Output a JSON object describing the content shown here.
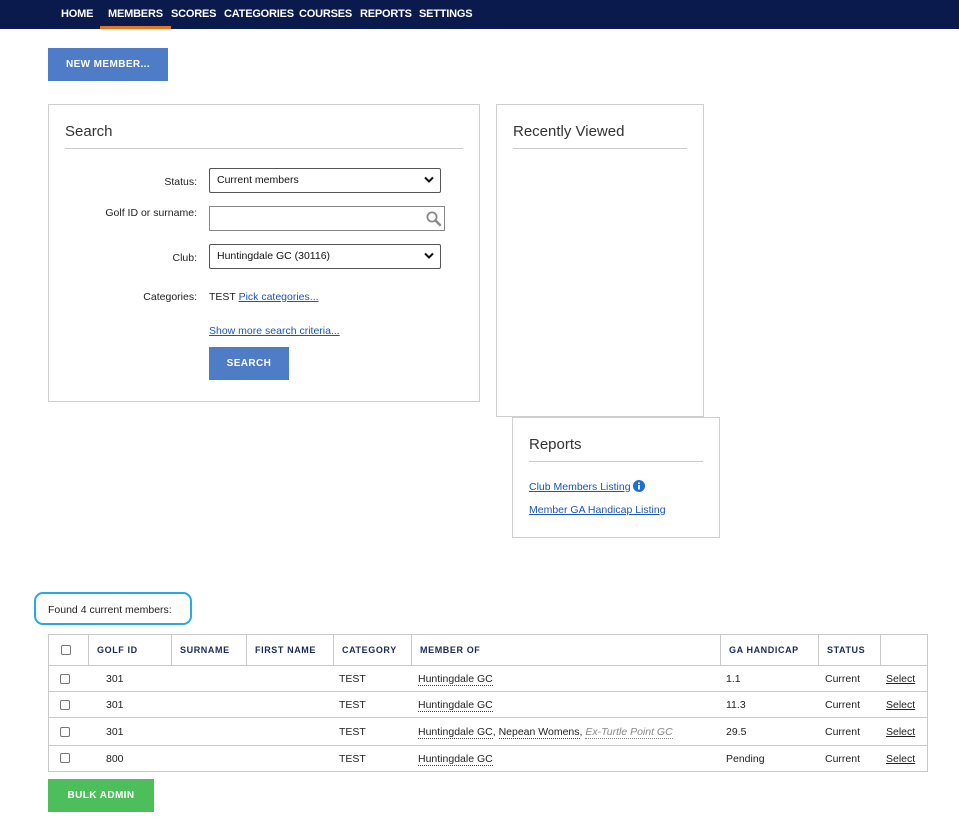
{
  "nav": {
    "items": [
      "HOME",
      "MEMBERS",
      "SCORES",
      "CATEGORIES",
      "COURSES",
      "REPORTS",
      "SETTINGS"
    ],
    "active": "MEMBERS"
  },
  "new_member_label": "NEW MEMBER...",
  "search": {
    "title": "Search",
    "status_label": "Status:",
    "status_value": "Current members",
    "golfid_label": "Golf ID or surname:",
    "golfid_value": "",
    "club_label": "Club:",
    "club_value": "Huntingdale GC (30116)",
    "categories_label": "Categories:",
    "categories_value": "TEST",
    "pick_categories": "Pick categories...",
    "show_more": "Show more search criteria...",
    "search_button": "SEARCH"
  },
  "recently_viewed": {
    "title": "Recently Viewed"
  },
  "reports": {
    "title": "Reports",
    "links": [
      "Club Members Listing",
      "Member GA Handicap Listing"
    ]
  },
  "found_text": "Found 4 current members:",
  "table": {
    "columns": [
      "GOLF ID",
      "SURNAME",
      "FIRST NAME",
      "CATEGORY",
      "MEMBER OF",
      "GA HANDICAP",
      "STATUS"
    ],
    "rows": [
      {
        "golf_id": "301",
        "surname": "",
        "first_name": "",
        "category": "TEST",
        "member_of": [
          "Huntingdale GC"
        ],
        "ex_member_of": "",
        "handicap": "1.1",
        "status": "Current",
        "action": "Select"
      },
      {
        "golf_id": "301",
        "surname": "",
        "first_name": "",
        "category": "TEST",
        "member_of": [
          "Huntingdale GC"
        ],
        "ex_member_of": "",
        "handicap": "11.3",
        "status": "Current",
        "action": "Select"
      },
      {
        "golf_id": "301",
        "surname": "",
        "first_name": "",
        "category": "TEST",
        "member_of": [
          "Huntingdale GC",
          "Nepean Womens"
        ],
        "ex_member_of": "Ex-Turtle Point GC",
        "handicap": "29.5",
        "status": "Current",
        "action": "Select"
      },
      {
        "golf_id": "800",
        "surname": "",
        "first_name": "",
        "category": "TEST",
        "member_of": [
          "Huntingdale GC"
        ],
        "ex_member_of": "",
        "handicap": "Pending",
        "status": "Current",
        "action": "Select"
      }
    ]
  },
  "bulk_admin_label": "BULK ADMIN",
  "colors": {
    "nav_bg": "#0b1a4d",
    "nav_active_underline": "#e87722",
    "primary_button": "#4e7cc7",
    "success_button": "#4cbe5a",
    "link": "#1a55b8",
    "highlight_outline": "#2aa8e0",
    "info_icon": "#1a6fd1"
  },
  "icons": [
    "search-icon",
    "chevron-down-icon",
    "info-icon"
  ]
}
